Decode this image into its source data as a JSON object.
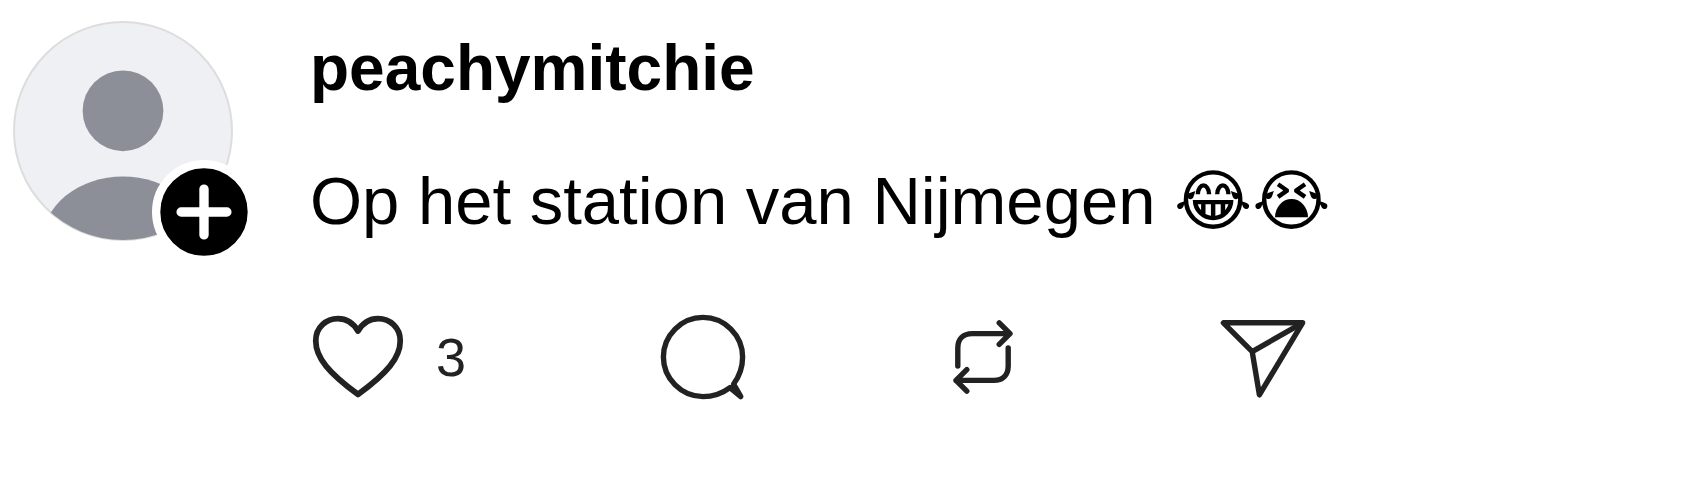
{
  "post": {
    "username": "peachymitchie",
    "text": "Op het station van Nijmegen 😂😭",
    "like_count": "3"
  }
}
